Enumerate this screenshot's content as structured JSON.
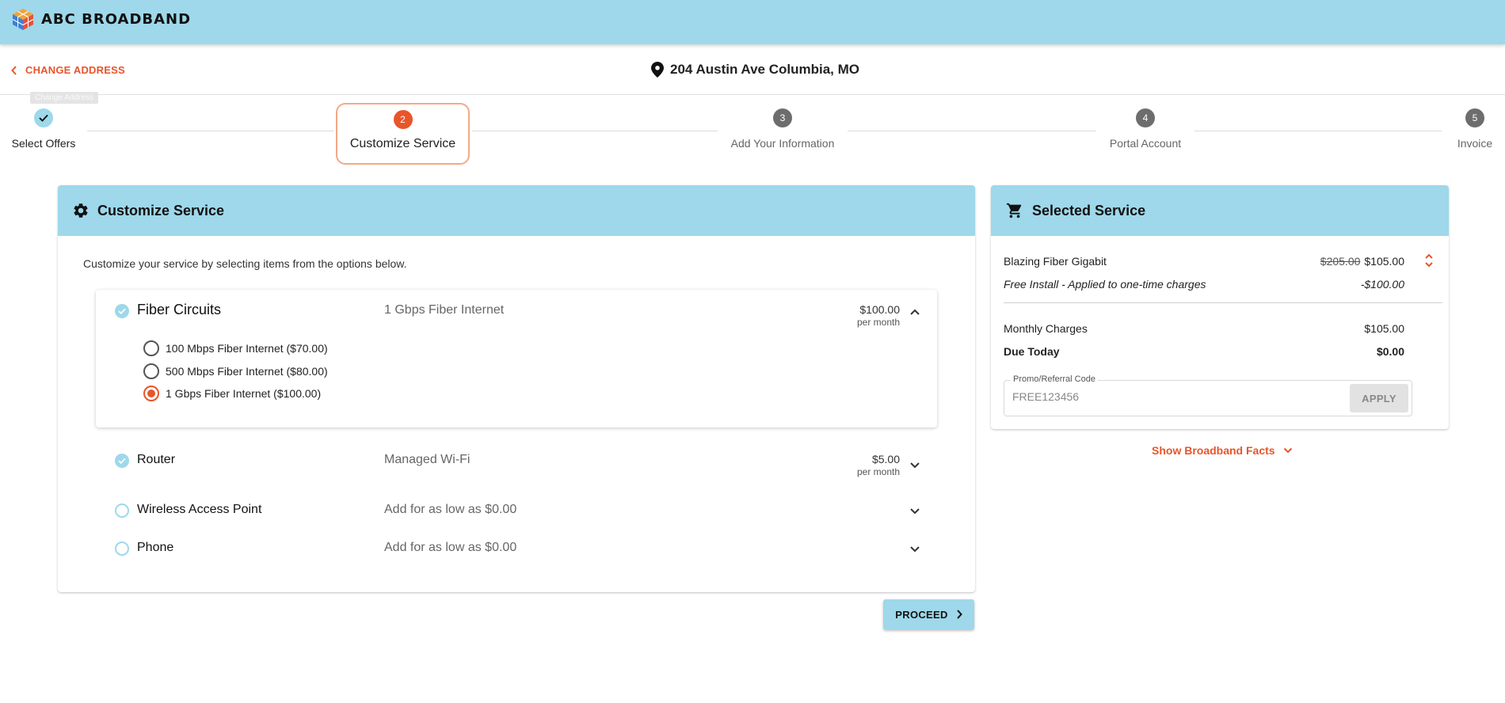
{
  "header": {
    "brand": "ABC BROADBAND"
  },
  "address_bar": {
    "change_address_label": "CHANGE ADDRESS",
    "tooltip": "Change Address",
    "address": "204 Austin Ave Columbia, MO"
  },
  "stepper": {
    "steps": [
      {
        "number": "",
        "label": "Select Offers",
        "state": "done"
      },
      {
        "number": "2",
        "label": "Customize Service",
        "state": "active"
      },
      {
        "number": "3",
        "label": "Add Your Information",
        "state": "pending"
      },
      {
        "number": "4",
        "label": "Portal Account",
        "state": "pending"
      },
      {
        "number": "5",
        "label": "Invoice",
        "state": "pending"
      }
    ]
  },
  "customize": {
    "title": "Customize Service",
    "intro": "Customize your service by selecting items from the options below.",
    "items": [
      {
        "name": "Fiber Circuits",
        "description": "1 Gbps Fiber Internet",
        "price": "$100.00",
        "period": "per month",
        "selected": true,
        "expanded": true
      },
      {
        "name": "Router",
        "description": "Managed Wi-Fi",
        "price": "$5.00",
        "period": "per month",
        "selected": true,
        "expanded": false
      },
      {
        "name": "Wireless Access Point",
        "description": "Add for as low as $0.00",
        "price": "",
        "period": "",
        "selected": false,
        "expanded": false
      },
      {
        "name": "Phone",
        "description": "Add for as low as $0.00",
        "price": "",
        "period": "",
        "selected": false,
        "expanded": false
      }
    ],
    "fiber_options": [
      {
        "label": "100 Mbps Fiber Internet ($70.00)",
        "selected": false
      },
      {
        "label": "500 Mbps Fiber Internet ($80.00)",
        "selected": false
      },
      {
        "label": "1 Gbps Fiber Internet ($100.00)",
        "selected": true
      }
    ],
    "proceed_label": "PROCEED"
  },
  "selected_service": {
    "title": "Selected Service",
    "plan_name": "Blazing Fiber Gigabit",
    "plan_old_price": "$205.00",
    "plan_price": "$105.00",
    "promo_line": "Free Install - Applied to one-time charges",
    "promo_amount": "-$100.00",
    "monthly_label": "Monthly Charges",
    "monthly_value": "$105.00",
    "due_label": "Due Today",
    "due_value": "$0.00",
    "promo_field_label": "Promo/Referral Code",
    "promo_code_value": "FREE123456",
    "apply_label": "APPLY",
    "broadband_facts_label": "Show Broadband Facts"
  },
  "colors": {
    "accent": "#e8552a",
    "header_bg": "#9ed8ea",
    "step_pending": "#6d6d6d"
  },
  "icons": [
    "cube-logo-icon",
    "chevron-left-icon",
    "map-pin-icon",
    "check-icon",
    "gear-icon",
    "cart-icon",
    "chevron-up-icon",
    "chevron-down-icon",
    "chevron-right-icon",
    "sort-icon"
  ]
}
